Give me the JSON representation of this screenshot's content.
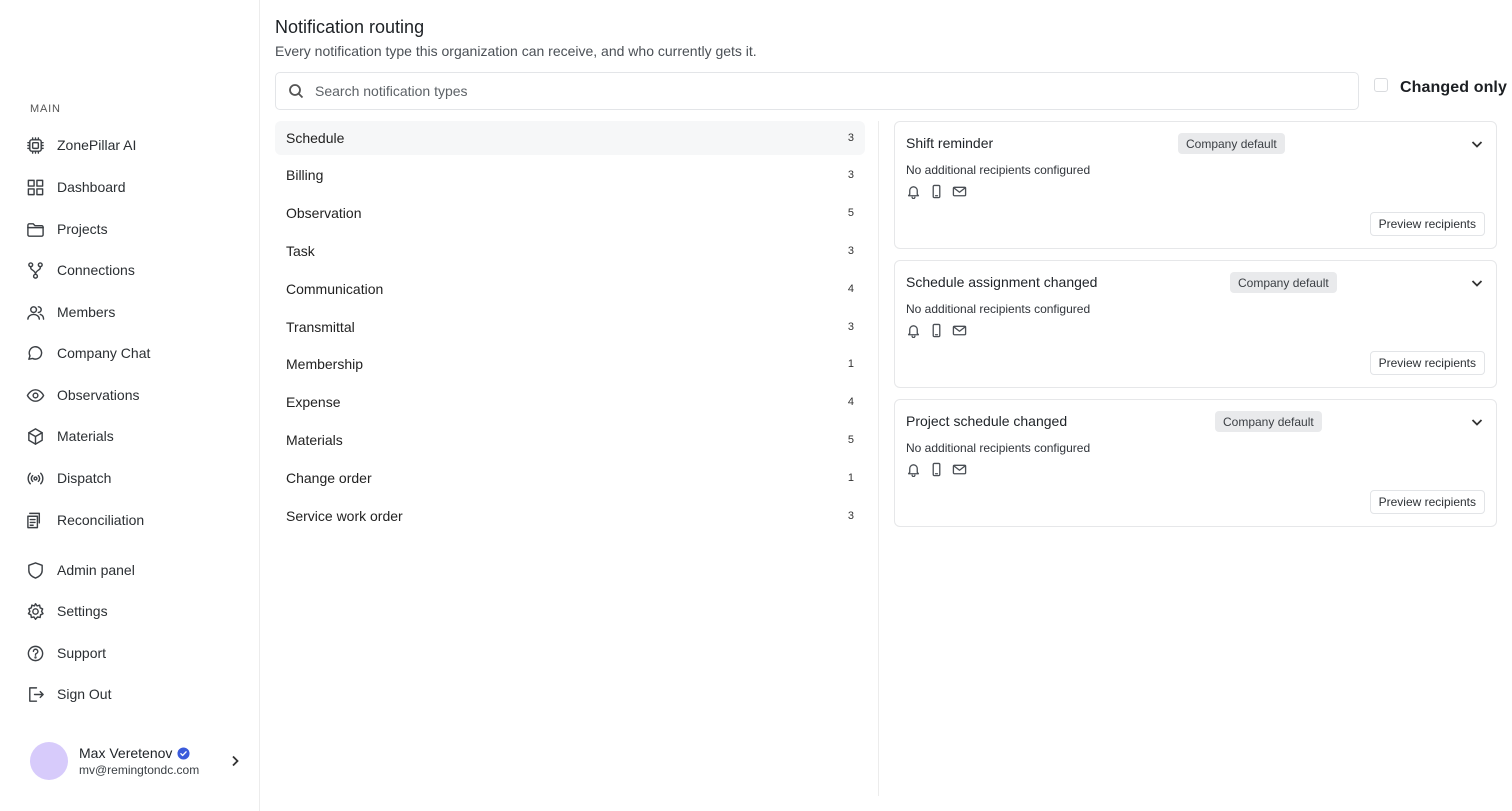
{
  "sidebar": {
    "section_label": "MAIN",
    "items": [
      {
        "label": "ZonePillar AI",
        "icon": "chip-icon"
      },
      {
        "label": "Dashboard",
        "icon": "grid-icon"
      },
      {
        "label": "Projects",
        "icon": "folder-icon"
      },
      {
        "label": "Connections",
        "icon": "fork-icon"
      },
      {
        "label": "Members",
        "icon": "users-icon"
      },
      {
        "label": "Company Chat",
        "icon": "chat-icon"
      },
      {
        "label": "Observations",
        "icon": "eye-icon"
      },
      {
        "label": "Materials",
        "icon": "box-icon"
      },
      {
        "label": "Dispatch",
        "icon": "broadcast-icon"
      },
      {
        "label": "Reconciliation",
        "icon": "receipt-icon"
      }
    ],
    "bottom_items": [
      {
        "label": "Admin panel",
        "icon": "shield-icon"
      },
      {
        "label": "Settings",
        "icon": "gear-icon"
      },
      {
        "label": "Support",
        "icon": "help-icon"
      },
      {
        "label": "Sign Out",
        "icon": "sign-out-icon"
      }
    ],
    "user": {
      "name": "Max Veretenov",
      "email": "mv@remingtondc.com"
    }
  },
  "header": {
    "title": "Notification routing",
    "subtitle": "Every notification type this organization can receive, and who currently gets it."
  },
  "search": {
    "placeholder": "Search notification types",
    "value": ""
  },
  "filter": {
    "changed_only_label": "Changed only",
    "checked": false
  },
  "categories": [
    {
      "label": "Schedule",
      "count": "3",
      "active": true
    },
    {
      "label": "Billing",
      "count": "3"
    },
    {
      "label": "Observation",
      "count": "5"
    },
    {
      "label": "Task",
      "count": "3"
    },
    {
      "label": "Communication",
      "count": "4"
    },
    {
      "label": "Transmittal",
      "count": "3"
    },
    {
      "label": "Membership",
      "count": "1"
    },
    {
      "label": "Expense",
      "count": "4"
    },
    {
      "label": "Materials",
      "count": "5"
    },
    {
      "label": "Change order",
      "count": "1"
    },
    {
      "label": "Service work order",
      "count": "3"
    }
  ],
  "notifications": [
    {
      "title": "Shift reminder",
      "badge": "Company default",
      "recipients": "No additional recipients configured",
      "button": "Preview recipients"
    },
    {
      "title": "Schedule assignment changed",
      "badge": "Company default",
      "recipients": "No additional recipients configured",
      "button": "Preview recipients"
    },
    {
      "title": "Project schedule changed",
      "badge": "Company default",
      "recipients": "No additional recipients configured",
      "button": "Preview recipients"
    }
  ],
  "colors": {
    "avatar": "#d7cbfb",
    "verified": "#3b5bdb",
    "active_category_bg": "#f6f7f8",
    "badge_bg": "#e9eaec"
  }
}
